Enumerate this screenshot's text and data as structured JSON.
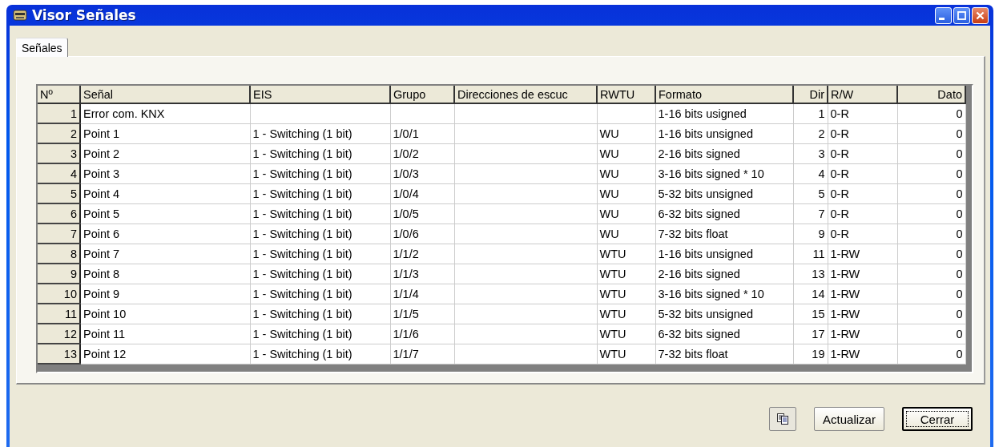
{
  "window": {
    "title": "Visor Señales"
  },
  "tabs": [
    {
      "label": "Señales",
      "selected": true
    }
  ],
  "table": {
    "columns": [
      "Nº",
      "Señal",
      "EIS",
      "Grupo",
      "Direcciones de escuc",
      "RWTU",
      "Formato",
      "Dir",
      "R/W",
      "Dato"
    ],
    "rows": [
      [
        "1",
        "Error com. KNX",
        "",
        "",
        "",
        "",
        "1-16 bits usigned",
        "1",
        "0-R",
        "0"
      ],
      [
        "2",
        "Point 1",
        "1 - Switching (1 bit)",
        "1/0/1",
        "",
        "WU",
        "1-16 bits unsigned",
        "2",
        "0-R",
        "0"
      ],
      [
        "3",
        "Point 2",
        "1 - Switching (1 bit)",
        "1/0/2",
        "",
        "WU",
        "2-16 bits signed",
        "3",
        "0-R",
        "0"
      ],
      [
        "4",
        "Point 3",
        "1 - Switching (1 bit)",
        "1/0/3",
        "",
        "WU",
        "3-16 bits signed * 10",
        "4",
        "0-R",
        "0"
      ],
      [
        "5",
        "Point 4",
        "1 - Switching (1 bit)",
        "1/0/4",
        "",
        "WU",
        "5-32 bits unsigned",
        "5",
        "0-R",
        "0"
      ],
      [
        "6",
        "Point 5",
        "1 - Switching (1 bit)",
        "1/0/5",
        "",
        "WU",
        "6-32 bits signed",
        "7",
        "0-R",
        "0"
      ],
      [
        "7",
        "Point 6",
        "1 - Switching (1 bit)",
        "1/0/6",
        "",
        "WU",
        "7-32 bits float",
        "9",
        "0-R",
        "0"
      ],
      [
        "8",
        "Point 7",
        "1 - Switching (1 bit)",
        "1/1/2",
        "",
        "WTU",
        "1-16 bits unsigned",
        "11",
        "1-RW",
        "0"
      ],
      [
        "9",
        "Point 8",
        "1 - Switching (1 bit)",
        "1/1/3",
        "",
        "WTU",
        "2-16 bits signed",
        "13",
        "1-RW",
        "0"
      ],
      [
        "10",
        "Point 9",
        "1 - Switching (1 bit)",
        "1/1/4",
        "",
        "WTU",
        "3-16 bits signed * 10",
        "14",
        "1-RW",
        "0"
      ],
      [
        "11",
        "Point 10",
        "1 - Switching (1 bit)",
        "1/1/5",
        "",
        "WTU",
        "5-32 bits unsigned",
        "15",
        "1-RW",
        "0"
      ],
      [
        "12",
        "Point 11",
        "1 - Switching (1 bit)",
        "1/1/6",
        "",
        "WTU",
        "6-32 bits signed",
        "17",
        "1-RW",
        "0"
      ],
      [
        "13",
        "Point 12",
        "1 - Switching (1 bit)",
        "1/1/7",
        "",
        "WTU",
        "7-32 bits float",
        "19",
        "1-RW",
        "0"
      ]
    ]
  },
  "buttons": [
    {
      "kind": "icon"
    },
    {
      "kind": "text",
      "label": "Actualizar",
      "focused": false
    },
    {
      "kind": "text",
      "label": "Cerrar",
      "focused": true
    }
  ]
}
